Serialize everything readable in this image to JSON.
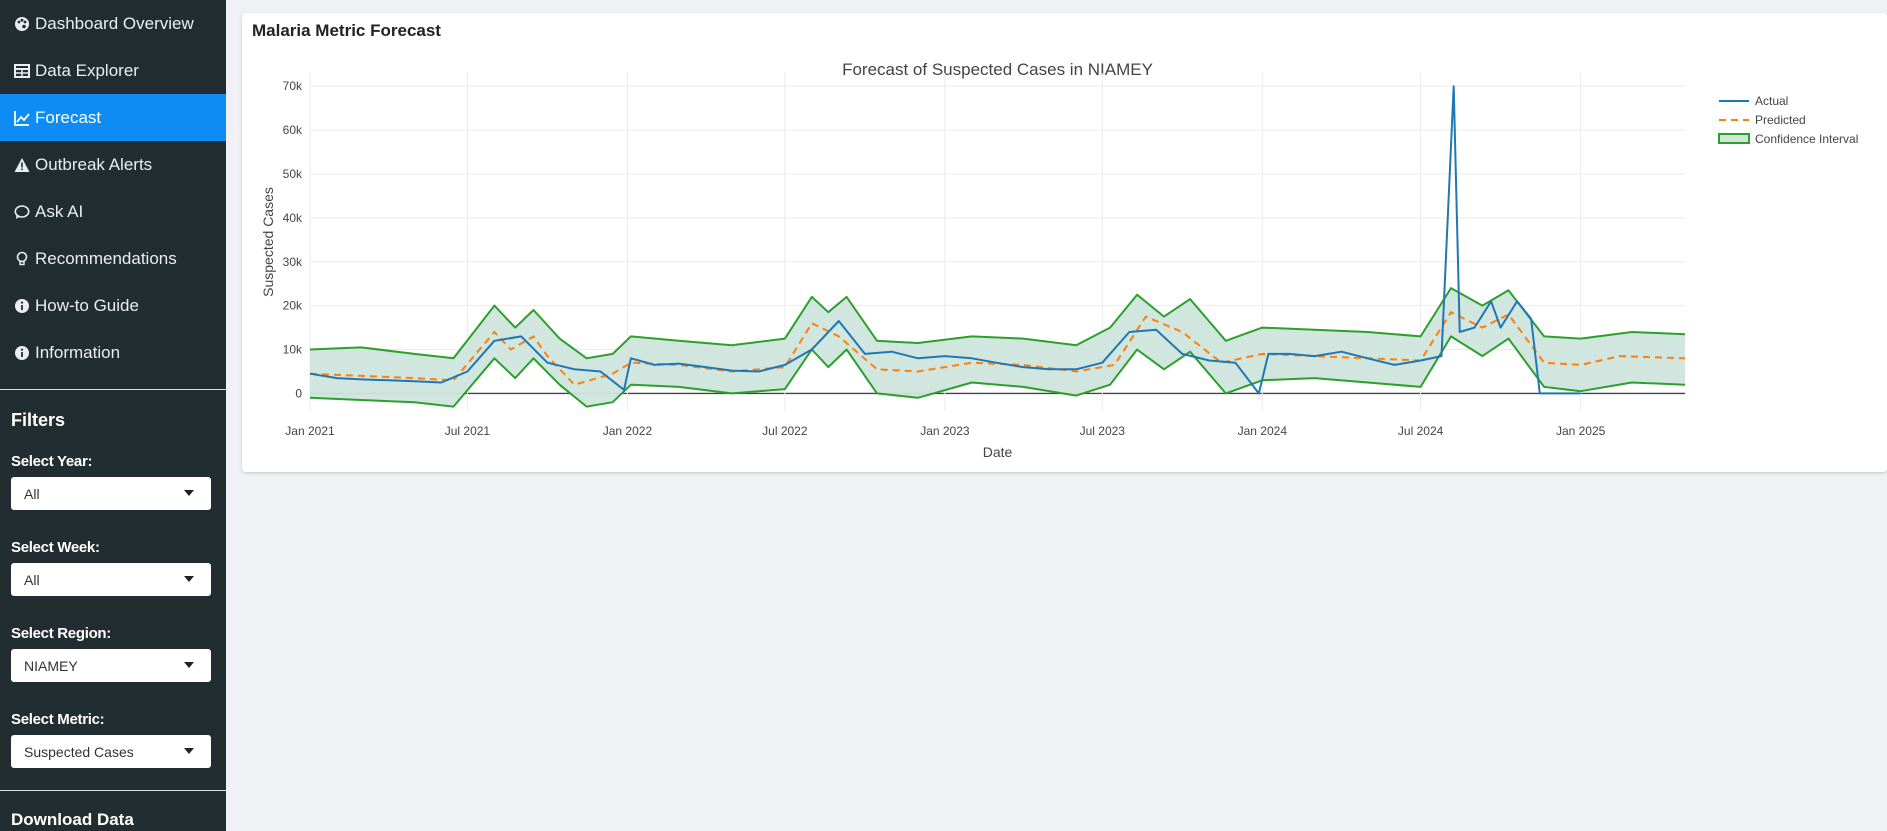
{
  "sidebar": {
    "menu": [
      {
        "label": "Dashboard Overview",
        "icon": "palette-icon"
      },
      {
        "label": "Data Explorer",
        "icon": "table-icon"
      },
      {
        "label": "Forecast",
        "icon": "line-chart-icon",
        "active": true
      },
      {
        "label": "Outbreak Alerts",
        "icon": "warning-icon"
      },
      {
        "label": "Ask AI",
        "icon": "chat-bubble-icon"
      },
      {
        "label": "Recommendations",
        "icon": "lightbulb-icon"
      },
      {
        "label": "How-to Guide",
        "icon": "info-circle-icon"
      },
      {
        "label": "Information",
        "icon": "info-circle-icon"
      }
    ],
    "filters_title": "Filters",
    "filters": [
      {
        "label": "Select Year:",
        "value": "All"
      },
      {
        "label": "Select Week:",
        "value": "All"
      },
      {
        "label": "Select Region:",
        "value": "NIAMEY"
      },
      {
        "label": "Select Metric:",
        "value": "Suspected Cases"
      }
    ],
    "download_label": "Download Data"
  },
  "card": {
    "title": "Malaria Metric Forecast"
  },
  "colors": {
    "sidebar_bg": "#222d32",
    "active": "#0d8cf5",
    "actual": "#1f77b4",
    "predicted": "#ff7f0e",
    "ci_line": "#2ca02c",
    "ci_fill": "#cfe5dc"
  },
  "chart_data": {
    "type": "line",
    "title": "Forecast of Suspected Cases in NIAMEY",
    "xlabel": "Date",
    "ylabel": "Suspected Cases",
    "xlim": [
      "2021-01-01",
      "2025-05-01"
    ],
    "ylim": [
      -4000,
      73000
    ],
    "y_ticks": [
      0,
      10000,
      20000,
      30000,
      40000,
      50000,
      60000,
      70000
    ],
    "y_tick_labels": [
      "0",
      "10k",
      "20k",
      "30k",
      "40k",
      "50k",
      "60k",
      "70k"
    ],
    "x_ticks": [
      "2021-01-01",
      "2021-07-01",
      "2022-01-01",
      "2022-07-01",
      "2023-01-01",
      "2023-07-01",
      "2024-01-01",
      "2024-07-01",
      "2025-01-01"
    ],
    "x_tick_labels": [
      "Jan 2021",
      "Jul 2021",
      "Jan 2022",
      "Jul 2022",
      "Jan 2023",
      "Jul 2023",
      "Jan 2024",
      "Jul 2024",
      "Jan 2025"
    ],
    "grid": true,
    "legend_position": "top-right",
    "legend": [
      "Actual",
      "Predicted",
      "Confidence Interval"
    ],
    "series": [
      {
        "name": "Actual",
        "style": "solid",
        "x": [
          "2021-01-01",
          "2021-02-01",
          "2021-03-01",
          "2021-04-01",
          "2021-05-01",
          "2021-06-01",
          "2021-07-01",
          "2021-08-01",
          "2021-09-01",
          "2021-10-01",
          "2021-11-01",
          "2021-12-01",
          "2021-12-28",
          "2022-01-05",
          "2022-02-01",
          "2022-03-01",
          "2022-04-01",
          "2022-05-01",
          "2022-06-01",
          "2022-07-01",
          "2022-08-01",
          "2022-09-01",
          "2022-10-01",
          "2022-11-01",
          "2022-12-01",
          "2023-01-01",
          "2023-02-01",
          "2023-03-01",
          "2023-04-01",
          "2023-05-01",
          "2023-06-01",
          "2023-07-01",
          "2023-08-01",
          "2023-09-01",
          "2023-10-01",
          "2023-11-01",
          "2023-12-01",
          "2023-12-28",
          "2024-01-08",
          "2024-02-01",
          "2024-03-01",
          "2024-04-01",
          "2024-05-01",
          "2024-06-01",
          "2024-07-01",
          "2024-07-25",
          "2024-08-08",
          "2024-08-15",
          "2024-09-01",
          "2024-09-20",
          "2024-10-01",
          "2024-10-20",
          "2024-11-05",
          "2024-11-15",
          "2024-12-01",
          "2025-01-01"
        ],
        "y": [
          4500,
          3500,
          3200,
          3000,
          2800,
          2500,
          5000,
          12000,
          13000,
          7000,
          5500,
          5000,
          800,
          8000,
          6500,
          6800,
          6000,
          5200,
          5000,
          6500,
          10000,
          16500,
          9000,
          9500,
          8000,
          8500,
          8000,
          7000,
          6000,
          5500,
          5500,
          7000,
          14000,
          14500,
          9000,
          7500,
          7000,
          0,
          9000,
          9000,
          8500,
          9500,
          8000,
          6500,
          7500,
          8500,
          70000,
          14000,
          15000,
          21000,
          15000,
          21000,
          17000,
          0,
          0,
          0
        ]
      },
      {
        "name": "Predicted",
        "style": "dashed",
        "x": [
          "2021-01-01",
          "2021-03-01",
          "2021-05-01",
          "2021-06-15",
          "2021-08-01",
          "2021-08-20",
          "2021-09-15",
          "2021-10-01",
          "2021-11-01",
          "2021-12-15",
          "2022-01-05",
          "2022-03-01",
          "2022-05-01",
          "2022-07-01",
          "2022-08-01",
          "2022-09-01",
          "2022-10-15",
          "2022-12-01",
          "2023-02-01",
          "2023-04-01",
          "2023-06-01",
          "2023-07-15",
          "2023-08-20",
          "2023-10-01",
          "2023-11-15",
          "2024-01-01",
          "2024-03-01",
          "2024-05-01",
          "2024-07-01",
          "2024-08-05",
          "2024-09-10",
          "2024-10-10",
          "2024-11-20",
          "2025-01-01",
          "2025-02-15",
          "2025-05-01"
        ],
        "y": [
          4500,
          4000,
          3500,
          3000,
          14000,
          10000,
          13000,
          8500,
          2000,
          4500,
          7000,
          6500,
          5000,
          6000,
          16000,
          13000,
          5500,
          5000,
          7000,
          6500,
          5000,
          6500,
          17500,
          14000,
          7000,
          9000,
          8500,
          8000,
          7500,
          18500,
          15000,
          18000,
          7000,
          6500,
          8500,
          8000
        ]
      },
      {
        "name": "CI upper",
        "style": "band",
        "x": [
          "2021-01-01",
          "2021-03-01",
          "2021-05-01",
          "2021-06-15",
          "2021-08-01",
          "2021-08-25",
          "2021-09-15",
          "2021-10-15",
          "2021-11-15",
          "2021-12-15",
          "2022-01-05",
          "2022-03-01",
          "2022-05-01",
          "2022-07-01",
          "2022-08-01",
          "2022-08-20",
          "2022-09-10",
          "2022-10-15",
          "2022-12-01",
          "2023-02-01",
          "2023-04-01",
          "2023-06-01",
          "2023-07-10",
          "2023-08-10",
          "2023-09-10",
          "2023-10-10",
          "2023-11-20",
          "2024-01-01",
          "2024-03-01",
          "2024-05-01",
          "2024-07-01",
          "2024-08-05",
          "2024-09-10",
          "2024-10-10",
          "2024-11-20",
          "2025-01-01",
          "2025-03-01",
          "2025-05-01"
        ],
        "y": [
          10000,
          10500,
          9000,
          8000,
          20000,
          15000,
          19000,
          12500,
          8000,
          9000,
          13000,
          12000,
          11000,
          12500,
          22000,
          18500,
          22000,
          12000,
          11500,
          13000,
          12500,
          11000,
          15000,
          22500,
          17500,
          21500,
          12000,
          15000,
          14500,
          14000,
          13000,
          24000,
          20000,
          23500,
          13000,
          12500,
          14000,
          13500
        ]
      },
      {
        "name": "CI lower",
        "style": "band",
        "x": [
          "2021-01-01",
          "2021-03-01",
          "2021-05-01",
          "2021-06-15",
          "2021-08-01",
          "2021-08-25",
          "2021-09-15",
          "2021-10-15",
          "2021-11-15",
          "2021-12-15",
          "2022-01-05",
          "2022-03-01",
          "2022-05-01",
          "2022-07-01",
          "2022-08-01",
          "2022-08-20",
          "2022-09-10",
          "2022-10-15",
          "2022-12-01",
          "2023-02-01",
          "2023-04-01",
          "2023-06-01",
          "2023-07-10",
          "2023-08-10",
          "2023-09-10",
          "2023-10-10",
          "2023-11-20",
          "2024-01-01",
          "2024-03-01",
          "2024-05-01",
          "2024-07-01",
          "2024-08-05",
          "2024-09-10",
          "2024-10-10",
          "2024-11-20",
          "2025-01-01",
          "2025-03-01",
          "2025-05-01"
        ],
        "y": [
          -1000,
          -1500,
          -2000,
          -3000,
          8000,
          3500,
          8000,
          2000,
          -3000,
          -2000,
          2000,
          1500,
          0,
          1000,
          10000,
          6000,
          10000,
          0,
          -1000,
          2500,
          1500,
          -500,
          2000,
          10000,
          5500,
          9500,
          0,
          3000,
          3500,
          2500,
          1500,
          13000,
          8500,
          12500,
          1500,
          500,
          2500,
          2000
        ]
      }
    ]
  }
}
